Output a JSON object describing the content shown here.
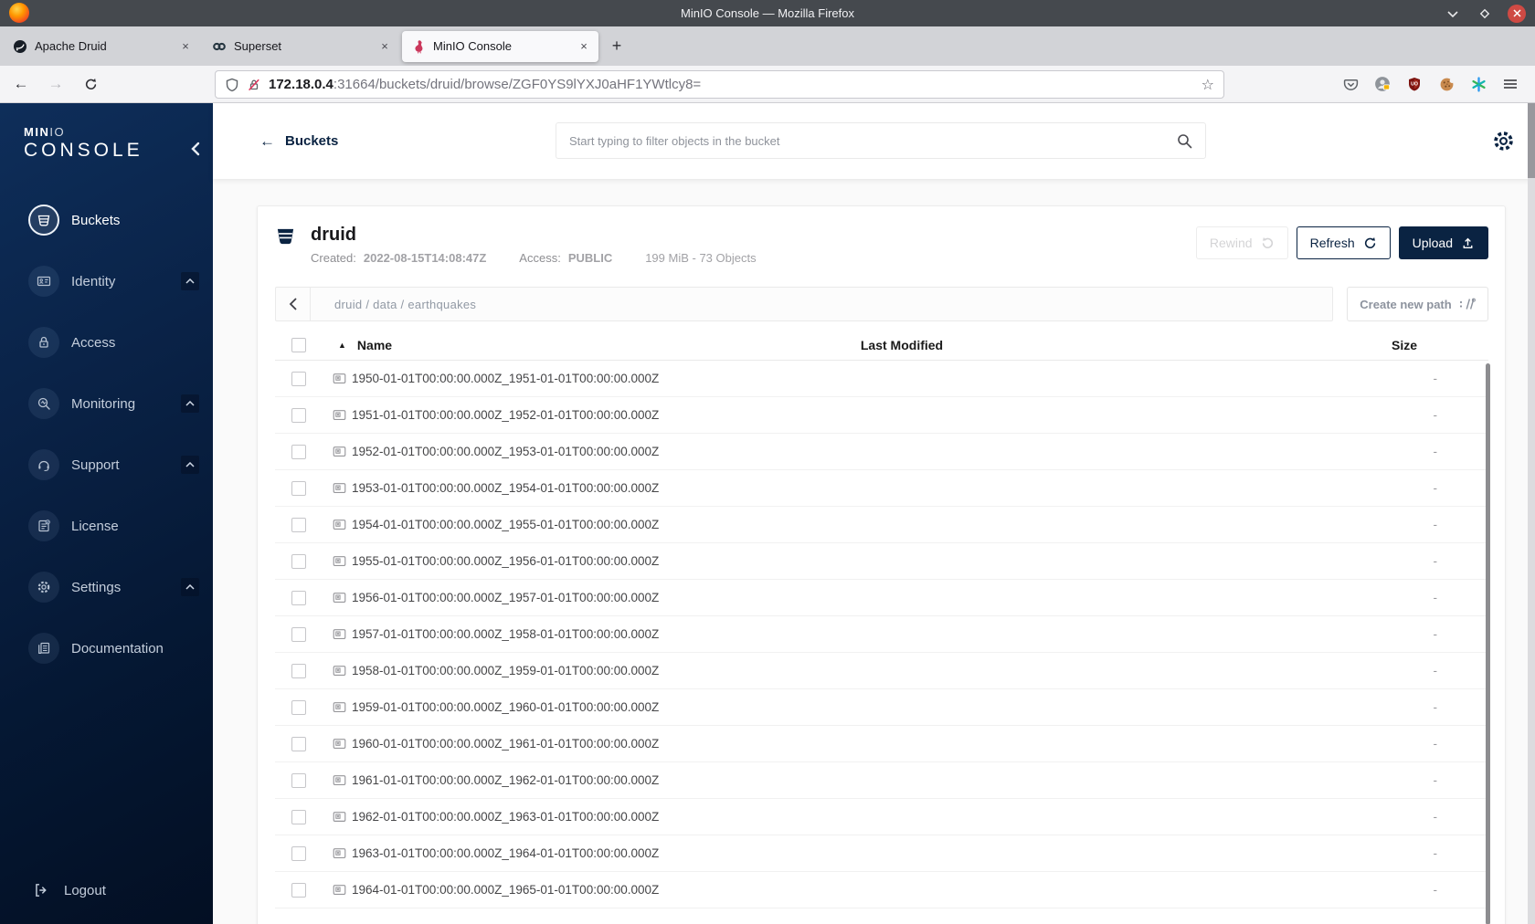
{
  "browser": {
    "window_title": "MinIO Console — Mozilla Firefox",
    "tabs": [
      {
        "title": "Apache Druid",
        "favicon": "druid-logo",
        "close_glyph": "×"
      },
      {
        "title": "Superset",
        "favicon": "superset-logo",
        "close_glyph": "×"
      },
      {
        "title": "MinIO Console",
        "favicon": "minio-logo",
        "close_glyph": "×",
        "active": true
      }
    ],
    "new_tab_glyph": "+",
    "nav": {
      "back_glyph": "←",
      "forward_glyph": "→",
      "bookmark_star_glyph": "☆"
    },
    "url": {
      "host": "172.18.0.4",
      "rest": ":31664/buckets/druid/browse/ZGF0YS9lYXJ0aHF1YWtlcy8="
    },
    "toolbar_icons": [
      "shield-icon",
      "lock-slash-icon",
      "reload-icon",
      "pocket-icon",
      "account-icon",
      "ublock-icon",
      "cookie-icon",
      "extensions-asterisk-icon",
      "menu-icon"
    ],
    "window_controls": [
      "minimize-chevron-icon",
      "maximize-diamond-icon",
      "close-circle-icon"
    ]
  },
  "sidebar": {
    "logo_bold": "MIN",
    "logo_light": "IO",
    "logo_main": "CONSOLE",
    "items": [
      {
        "label": "Buckets",
        "icon": "bucket-icon",
        "active": true,
        "expandable": false
      },
      {
        "label": "Identity",
        "icon": "id-card-icon",
        "active": false,
        "expandable": true
      },
      {
        "label": "Access",
        "icon": "lock-icon",
        "active": false,
        "expandable": false
      },
      {
        "label": "Monitoring",
        "icon": "monitor-search-icon",
        "active": false,
        "expandable": true
      },
      {
        "label": "Support",
        "icon": "support-icon",
        "active": false,
        "expandable": true
      },
      {
        "label": "License",
        "icon": "license-icon",
        "active": false,
        "expandable": false
      },
      {
        "label": "Settings",
        "icon": "gear-icon",
        "active": false,
        "expandable": true
      },
      {
        "label": "Documentation",
        "icon": "docs-icon",
        "active": false,
        "expandable": false
      }
    ],
    "logout_label": "Logout"
  },
  "topbar": {
    "back_arrow": "←",
    "back_label": "Buckets",
    "search_placeholder": "Start typing to filter objects in the bucket"
  },
  "bucket_header": {
    "name": "druid",
    "created_label": "Created:",
    "created_value": "2022-08-15T14:08:47Z",
    "access_label": "Access:",
    "access_value": "PUBLIC",
    "usage": "199 MiB - 73 Objects",
    "buttons": {
      "rewind": "Rewind",
      "refresh": "Refresh",
      "upload": "Upload"
    }
  },
  "path_bar": {
    "segments": [
      "druid",
      "data",
      "earthquakes"
    ],
    "path_display": "druid / data / earthquakes",
    "create_button": "Create new path"
  },
  "table": {
    "headers": {
      "name": "Name",
      "last_modified": "Last Modified",
      "size": "Size"
    },
    "sort_indicator": "▲",
    "rows": [
      {
        "name": "1950-01-01T00:00:00.000Z_1951-01-01T00:00:00.000Z",
        "last_modified": "",
        "size": "-"
      },
      {
        "name": "1951-01-01T00:00:00.000Z_1952-01-01T00:00:00.000Z",
        "last_modified": "",
        "size": "-"
      },
      {
        "name": "1952-01-01T00:00:00.000Z_1953-01-01T00:00:00.000Z",
        "last_modified": "",
        "size": "-"
      },
      {
        "name": "1953-01-01T00:00:00.000Z_1954-01-01T00:00:00.000Z",
        "last_modified": "",
        "size": "-"
      },
      {
        "name": "1954-01-01T00:00:00.000Z_1955-01-01T00:00:00.000Z",
        "last_modified": "",
        "size": "-"
      },
      {
        "name": "1955-01-01T00:00:00.000Z_1956-01-01T00:00:00.000Z",
        "last_modified": "",
        "size": "-"
      },
      {
        "name": "1956-01-01T00:00:00.000Z_1957-01-01T00:00:00.000Z",
        "last_modified": "",
        "size": "-"
      },
      {
        "name": "1957-01-01T00:00:00.000Z_1958-01-01T00:00:00.000Z",
        "last_modified": "",
        "size": "-"
      },
      {
        "name": "1958-01-01T00:00:00.000Z_1959-01-01T00:00:00.000Z",
        "last_modified": "",
        "size": "-"
      },
      {
        "name": "1959-01-01T00:00:00.000Z_1960-01-01T00:00:00.000Z",
        "last_modified": "",
        "size": "-"
      },
      {
        "name": "1960-01-01T00:00:00.000Z_1961-01-01T00:00:00.000Z",
        "last_modified": "",
        "size": "-"
      },
      {
        "name": "1961-01-01T00:00:00.000Z_1962-01-01T00:00:00.000Z",
        "last_modified": "",
        "size": "-"
      },
      {
        "name": "1962-01-01T00:00:00.000Z_1963-01-01T00:00:00.000Z",
        "last_modified": "",
        "size": "-"
      },
      {
        "name": "1963-01-01T00:00:00.000Z_1964-01-01T00:00:00.000Z",
        "last_modified": "",
        "size": "-"
      },
      {
        "name": "1964-01-01T00:00:00.000Z_1965-01-01T00:00:00.000Z",
        "last_modified": "",
        "size": "-"
      }
    ]
  },
  "colors": {
    "sidebar_navy": "#0a2348",
    "accent_navy": "#0a2342",
    "minio_red": "#cb385c",
    "close_button_red": "#cf4a44"
  }
}
